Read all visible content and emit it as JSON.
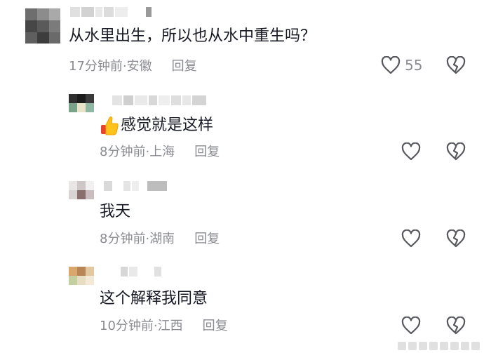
{
  "comments": [
    {
      "text": "从水里出生，所以也从水中重生吗？",
      "time": "17分钟前",
      "location": "安徽",
      "reply_label": "回复",
      "likes": "55"
    },
    {
      "text": "感觉就是这样",
      "time": "8分钟前",
      "location": "上海",
      "reply_label": "回复",
      "emoji": "thumbs-up-emoji"
    },
    {
      "text": "我天",
      "time": "8分钟前",
      "location": "湖南",
      "reply_label": "回复"
    },
    {
      "text": "这个解释我同意",
      "time": "10分钟前",
      "location": "江西",
      "reply_label": "回复"
    }
  ],
  "separator": " · ",
  "colors": {
    "text": "#161823",
    "meta": "#8a8b91",
    "icon": "#57585e"
  },
  "icons": [
    "heart-outline-icon",
    "broken-heart-icon",
    "thumbs-up-emoji"
  ]
}
